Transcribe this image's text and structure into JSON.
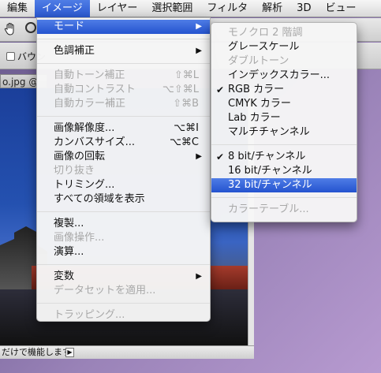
{
  "menubar": {
    "items": [
      {
        "label": "編集",
        "active": false
      },
      {
        "label": "イメージ",
        "active": true
      },
      {
        "label": "レイヤー",
        "active": false
      },
      {
        "label": "選択範囲",
        "active": false
      },
      {
        "label": "フィルタ",
        "active": false
      },
      {
        "label": "解析",
        "active": false
      },
      {
        "label": "3D",
        "active": false
      },
      {
        "label": "ビュー",
        "active": false
      }
    ]
  },
  "options": {
    "checkbox_label": "バウン"
  },
  "document": {
    "tab_title": "o.jpg @",
    "status_text": "だけで機能します",
    "status_arrow": "▶"
  },
  "image_menu": {
    "items": [
      {
        "label": "モード",
        "shortcut": "",
        "submenu": true,
        "disabled": false,
        "highlighted": true
      },
      {
        "sep": true
      },
      {
        "label": "色調補正",
        "shortcut": "",
        "submenu": true,
        "disabled": false
      },
      {
        "sep": true
      },
      {
        "label": "自動トーン補正",
        "shortcut": "⇧⌘L",
        "submenu": false,
        "disabled": true
      },
      {
        "label": "自動コントラスト",
        "shortcut": "⌥⇧⌘L",
        "submenu": false,
        "disabled": true
      },
      {
        "label": "自動カラー補正",
        "shortcut": "⇧⌘B",
        "submenu": false,
        "disabled": true
      },
      {
        "sep": true
      },
      {
        "label": "画像解像度...",
        "shortcut": "⌥⌘I",
        "submenu": false,
        "disabled": false
      },
      {
        "label": "カンバスサイズ...",
        "shortcut": "⌥⌘C",
        "submenu": false,
        "disabled": false
      },
      {
        "label": "画像の回転",
        "shortcut": "",
        "submenu": true,
        "disabled": false
      },
      {
        "label": "切り抜き",
        "shortcut": "",
        "submenu": false,
        "disabled": true
      },
      {
        "label": "トリミング...",
        "shortcut": "",
        "submenu": false,
        "disabled": false
      },
      {
        "label": "すべての領域を表示",
        "shortcut": "",
        "submenu": false,
        "disabled": false
      },
      {
        "sep": true
      },
      {
        "label": "複製...",
        "shortcut": "",
        "submenu": false,
        "disabled": false
      },
      {
        "label": "画像操作...",
        "shortcut": "",
        "submenu": false,
        "disabled": true
      },
      {
        "label": "演算...",
        "shortcut": "",
        "submenu": false,
        "disabled": false
      },
      {
        "sep": true
      },
      {
        "label": "変数",
        "shortcut": "",
        "submenu": true,
        "disabled": false
      },
      {
        "label": "データセットを適用...",
        "shortcut": "",
        "submenu": false,
        "disabled": true
      },
      {
        "sep": true
      },
      {
        "label": "トラッピング...",
        "shortcut": "",
        "submenu": false,
        "disabled": true
      }
    ]
  },
  "mode_menu": {
    "items": [
      {
        "label": "モノクロ 2 階調",
        "disabled": true,
        "checked": false
      },
      {
        "label": "グレースケール",
        "disabled": false,
        "checked": false
      },
      {
        "label": "ダブルトーン",
        "disabled": true,
        "checked": false
      },
      {
        "label": "インデックスカラー...",
        "disabled": false,
        "checked": false
      },
      {
        "label": "RGB カラー",
        "disabled": false,
        "checked": true
      },
      {
        "label": "CMYK カラー",
        "disabled": false,
        "checked": false
      },
      {
        "label": "Lab カラー",
        "disabled": false,
        "checked": false
      },
      {
        "label": "マルチチャンネル",
        "disabled": false,
        "checked": false
      },
      {
        "sep": true
      },
      {
        "label": "8 bit/チャンネル",
        "disabled": false,
        "checked": true
      },
      {
        "label": "16 bit/チャンネル",
        "disabled": false,
        "checked": false
      },
      {
        "label": "32 bit/チャンネル",
        "disabled": false,
        "checked": false,
        "highlighted": true
      },
      {
        "sep": true
      },
      {
        "label": "カラーテーブル...",
        "disabled": true,
        "checked": false
      }
    ]
  },
  "colors": {
    "highlight": "#2a57cf",
    "disabled_text": "#a8a8a8"
  },
  "icons": {
    "check": "✔",
    "submenu_arrow": "▶"
  }
}
